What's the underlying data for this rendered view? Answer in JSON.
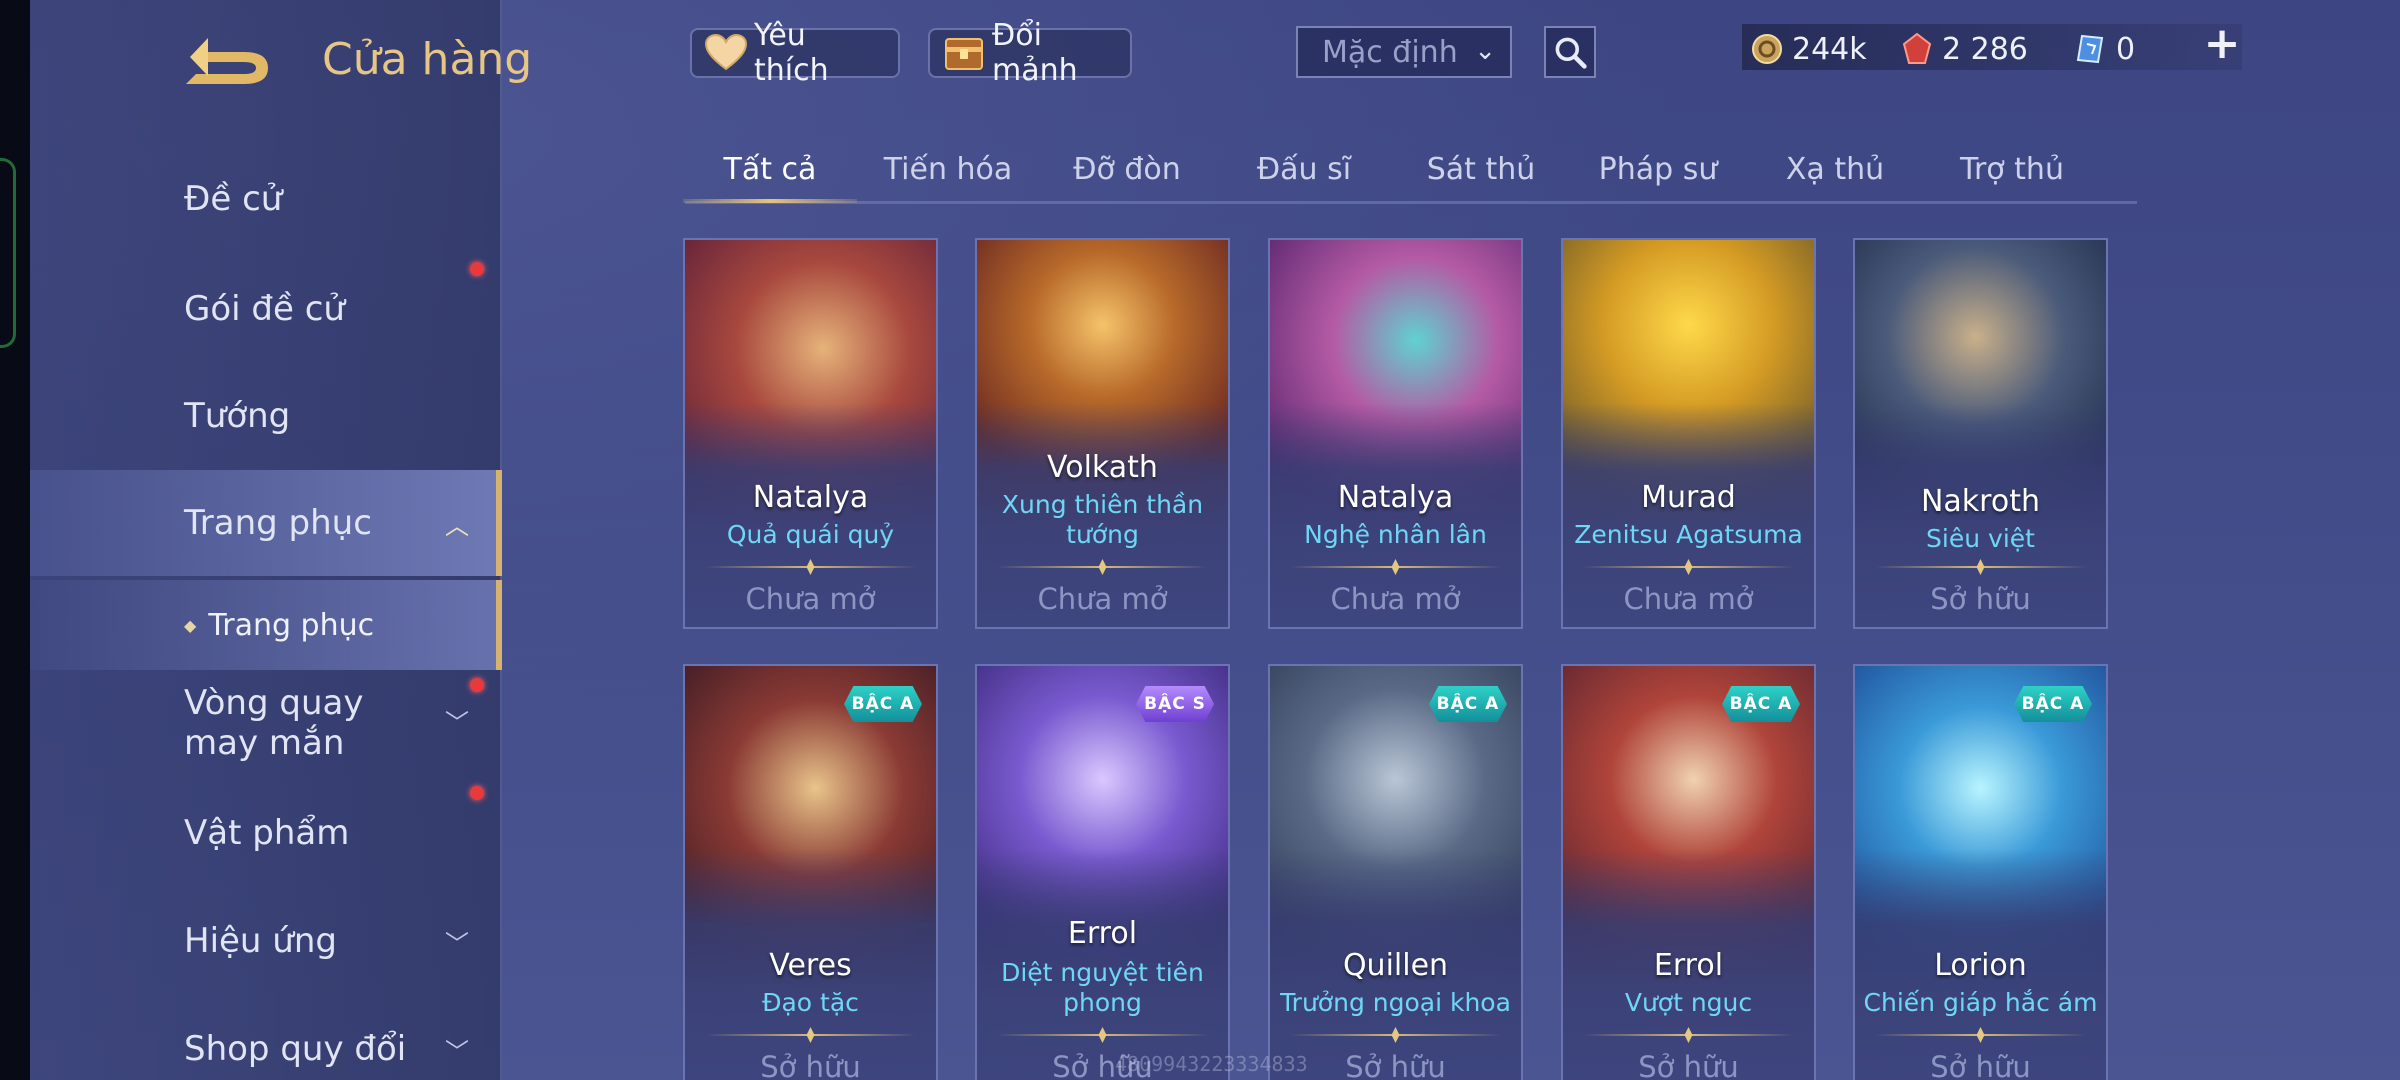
{
  "header": {
    "title": "Cửa hàng",
    "favorites_label": "Yêu thích",
    "exchange_label": "Đổi mảnh",
    "sort_value": "Mặc định"
  },
  "currency": {
    "gold": "244k",
    "gems": "2 286",
    "vouchers": "0"
  },
  "sidebar": {
    "items": [
      {
        "label": "Đề cử"
      },
      {
        "label": "Gói đề cử"
      },
      {
        "label": "Tướng"
      },
      {
        "label": "Trang phục"
      },
      {
        "label": "Vòng quay may mắn"
      },
      {
        "label": "Vật phẩm"
      },
      {
        "label": "Hiệu ứng"
      },
      {
        "label": "Shop quy đổi"
      }
    ],
    "subitem": "Trang phục"
  },
  "tabs": [
    "Tất cả",
    "Tiến hóa",
    "Đỡ đòn",
    "Đấu sĩ",
    "Sát thủ",
    "Pháp sư",
    "Xạ thủ",
    "Trợ thủ"
  ],
  "cards": [
    {
      "hero": "Natalya",
      "skin": "Quả quái quỷ",
      "status": "Chưa mở",
      "tier": ""
    },
    {
      "hero": "Volkath",
      "skin": "Xung thiên thần tướng",
      "status": "Chưa mở",
      "tier": ""
    },
    {
      "hero": "Natalya",
      "skin": "Nghệ nhân lân",
      "status": "Chưa mở",
      "tier": ""
    },
    {
      "hero": "Murad",
      "skin": "Zenitsu Agatsuma",
      "status": "Chưa mở",
      "tier": ""
    },
    {
      "hero": "Nakroth",
      "skin": "Siêu việt",
      "status": "Sở hữu",
      "tier": ""
    },
    {
      "hero": "Veres",
      "skin": "Đạo tặc",
      "status": "Sở hữu",
      "tier": "BẬC A"
    },
    {
      "hero": "Errol",
      "skin": "Diệt nguyệt tiên phong",
      "status": "Sở hữu",
      "tier": "BẬC S"
    },
    {
      "hero": "Quillen",
      "skin": "Trưởng ngoại khoa",
      "status": "Sở hữu",
      "tier": "BẬC A"
    },
    {
      "hero": "Errol",
      "skin": "Vượt ngục",
      "status": "Sở hữu",
      "tier": "BẬC A"
    },
    {
      "hero": "Lorion",
      "skin": "Chiến giáp hắc ám",
      "status": "Sở hữu",
      "tier": "BẬC A"
    }
  ],
  "watermark": "4809943223334833",
  "colors": {
    "accent_gold": "#d6b46f",
    "skin_name": "#6fd7f6",
    "badge_red": "#e83a3a"
  }
}
